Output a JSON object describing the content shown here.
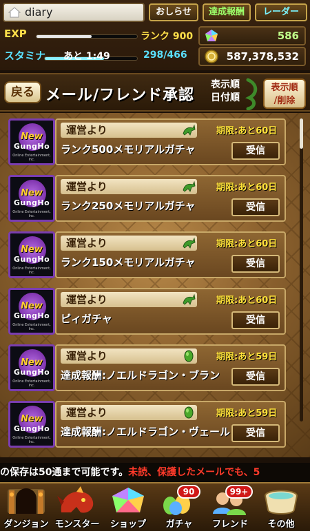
{
  "top": {
    "username": "diary",
    "buttons": {
      "notice": "おしらせ",
      "achievement": "達成報酬",
      "radar": "レーダー"
    },
    "exp": {
      "label": "EXP",
      "rank_text": "ランク 900",
      "progress": 0.55
    },
    "stamina": {
      "label": "スタミナ",
      "timer": "あと 1:49",
      "value": "298/466",
      "progress": 0.64
    },
    "stones": {
      "value": "586",
      "icon": "magic-stone-icon"
    },
    "coins": {
      "value": "587,378,532",
      "icon": "coin-icon"
    }
  },
  "header": {
    "back_label": "戻る",
    "title": "メール/フレンド承認",
    "sort_line1": "表示順",
    "sort_line2": "日付順",
    "sort_button_line1": "表示順",
    "sort_button_line2": "/削除"
  },
  "mails": [
    {
      "from": "運営より",
      "deadline": "期限:あと60日",
      "subject": "ランク500メモリアルガチャ",
      "receive": "受信",
      "icon": "dragon-icon"
    },
    {
      "from": "運営より",
      "deadline": "期限:あと60日",
      "subject": "ランク250メモリアルガチャ",
      "receive": "受信",
      "icon": "dragon-icon"
    },
    {
      "from": "運営より",
      "deadline": "期限:あと60日",
      "subject": "ランク150メモリアルガチャ",
      "receive": "受信",
      "icon": "dragon-icon"
    },
    {
      "from": "運営より",
      "deadline": "期限:あと60日",
      "subject": "ピィガチャ",
      "receive": "受信",
      "icon": "dragon-icon"
    },
    {
      "from": "運営より",
      "deadline": "期限:あと59日",
      "subject": "達成報酬:ノエルドラゴン・ブラン",
      "receive": "受信",
      "icon": "egg-icon"
    },
    {
      "from": "運営より",
      "deadline": "期限:あと59日",
      "subject": "達成報酬:ノエルドラゴン・ヴェール",
      "receive": "受信",
      "icon": "egg-icon"
    }
  ],
  "avatar_logo": {
    "line1": "New",
    "line2": "GungHo",
    "line3": "Online Entertainment, Inc."
  },
  "ticker": {
    "white_text": "の保存は50通まで可能です。",
    "red_text": "未読、保護したメールでも、5"
  },
  "nav": [
    {
      "label": "ダンジョン",
      "icon": "dungeon-gate-icon"
    },
    {
      "label": "モンスター",
      "icon": "red-dragon-icon"
    },
    {
      "label": "ショップ",
      "icon": "rainbow-gem-icon"
    },
    {
      "label": "ガチャ",
      "icon": "egg-machine-icon",
      "badge": "90"
    },
    {
      "label": "フレンド",
      "icon": "friends-icon",
      "badge": "99+"
    },
    {
      "label": "その他",
      "icon": "scroll-icon"
    }
  ],
  "colors": {
    "deadline": "#ffe23a",
    "ticker_red": "#ff3a2a",
    "avatar_border": "#7a3db0"
  }
}
